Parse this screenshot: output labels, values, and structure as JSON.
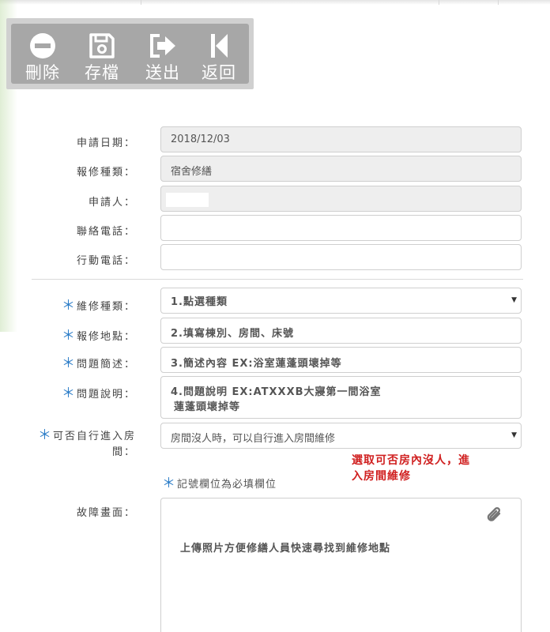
{
  "toolbar": {
    "delete_label": "刪除",
    "save_label": "存檔",
    "submit_label": "送出",
    "back_label": "返回"
  },
  "form": {
    "apply_date": {
      "label": "申請日期：",
      "value": "2018/12/03"
    },
    "repair_category": {
      "label": "報修種類：",
      "value": "宿舍修繕"
    },
    "applicant": {
      "label": "申請人：",
      "value": ""
    },
    "contact_phone": {
      "label": "聯絡電話：",
      "value": ""
    },
    "mobile_phone": {
      "label": "行動電話：",
      "value": ""
    },
    "repair_type": {
      "label": "維修種類：",
      "value": "1.點選種類"
    },
    "repair_location": {
      "label": "報修地點：",
      "value": "2.填寫棟別、房間、床號"
    },
    "problem_summary": {
      "label": "問題簡述：",
      "value": "3.簡述內容 EX:浴室蓮蓬頭壞掉等"
    },
    "problem_detail": {
      "label": "問題說明：",
      "value_line1": "4.問題說明 EX:ATXXXB大寢第一間浴室",
      "value_line2": "蓮蓬頭壞掉等"
    },
    "room_entry": {
      "label_line1": "可否自行進入房",
      "label_line2": "間：",
      "value": "房間沒人時，可以自行進入房間維修"
    },
    "room_entry_note_line1": "選取可否房內沒人，進",
    "room_entry_note_line2": "入房間維修",
    "required_hint": "記號欄位為必填欄位",
    "fault_photo": {
      "label": "故障畫面：",
      "note": "上傳照片方便修繕人員快速尋找到維修地點"
    }
  },
  "required_marker": "＊",
  "colors": {
    "accent": "#2a7cc7",
    "note": "#d02020",
    "toolbar": "#a7a7a7"
  },
  "icons": [
    "minus-circle-icon",
    "floppy-disk-icon",
    "sign-out-arrow-icon",
    "skip-back-icon",
    "paperclip-icon",
    "caret-down-icon"
  ]
}
